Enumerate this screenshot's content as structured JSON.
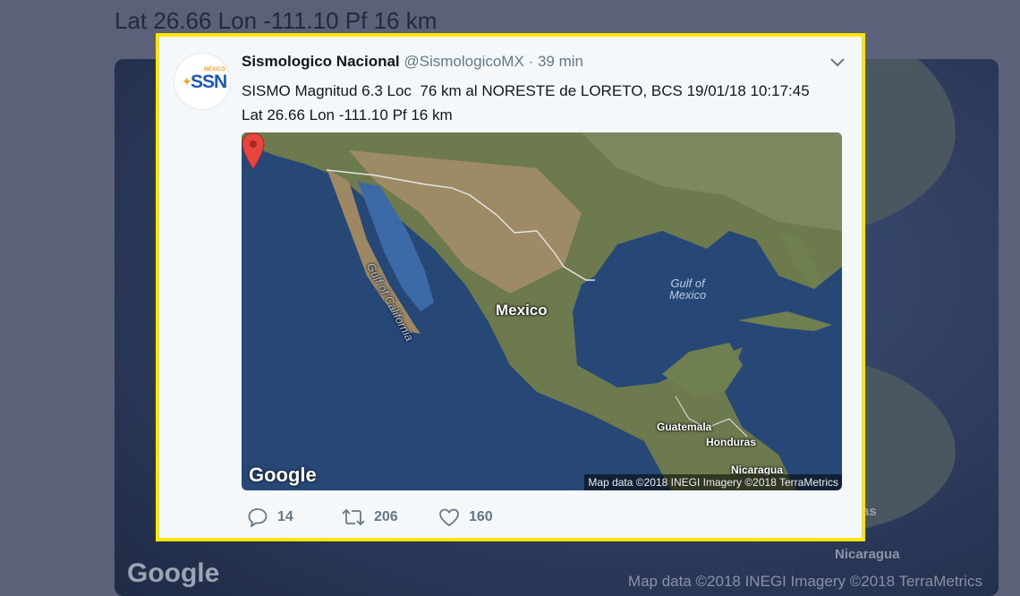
{
  "background": {
    "coords_text": "Lat 26.66 Lon -111.10 Pf 16 km",
    "google_logo": "Google",
    "credit_text": "Map data ©2018 INEGI  Imagery ©2018 TerraMetrics",
    "labels": [
      "Nicaragua",
      "as"
    ]
  },
  "tweet": {
    "avatar_icon": "ssn-logo-icon",
    "avatar_text": "SSN",
    "avatar_country": "MÉXICO",
    "display_name": "Sismologico Nacional",
    "handle": "@SismologicoMX",
    "separator": "·",
    "time": "39 min",
    "text_line1": "SISMO Magnitud 6.3 Loc  76 km al NORESTE de LORETO, BCS 19/01/18 10:17:45",
    "text_line2": "Lat 26.66 Lon -111.10 Pf 16 km",
    "map": {
      "labels": {
        "mexico": "Mexico",
        "gulf_of_mexico": "Gulf of\nMexico",
        "gulf_of_california": "Gulf of California",
        "guatemala": "Guatemala",
        "honduras": "Honduras",
        "nicaragua": "Nicaragua"
      },
      "google_logo": "Google",
      "credit": "Map data ©2018 INEGI  Imagery ©2018 TerraMetrics"
    },
    "actions": {
      "replies": "14",
      "retweets": "206",
      "likes": "160"
    }
  },
  "colors": {
    "highlight_border": "#ffe500",
    "text_primary": "#14171a",
    "text_secondary": "#657786",
    "pin": "#e8453c"
  }
}
